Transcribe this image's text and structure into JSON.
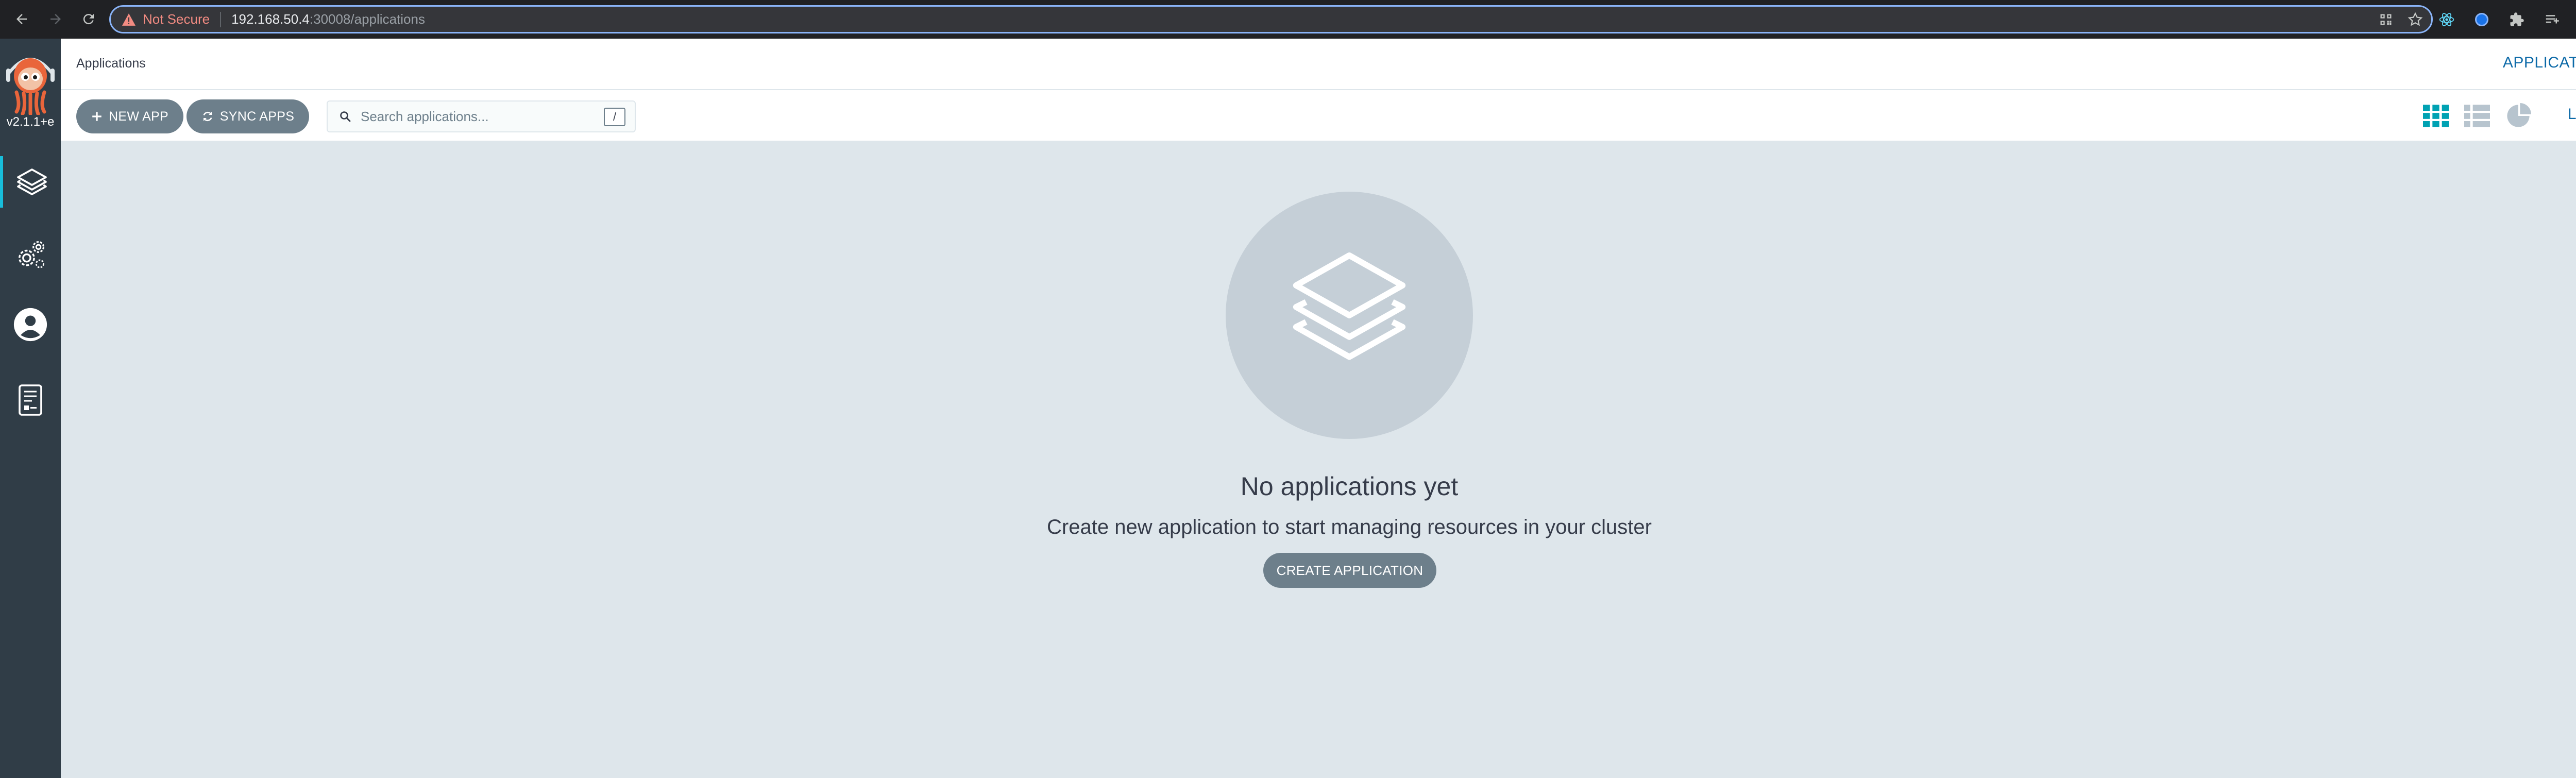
{
  "browser": {
    "security_label": "Not Secure",
    "url_host": "192.168.50.4",
    "url_path": ":30008/applications"
  },
  "sidebar": {
    "version": "v2.1.1+e",
    "items": [
      {
        "name": "applications",
        "icon": "layers-icon",
        "active": true
      },
      {
        "name": "settings",
        "icon": "gears-icon",
        "active": false
      },
      {
        "name": "user-info",
        "icon": "user-circle-icon",
        "active": false
      },
      {
        "name": "documentation",
        "icon": "docs-icon",
        "active": false
      }
    ]
  },
  "header": {
    "title": "Applications",
    "right_title": "APPLICATIONS"
  },
  "toolbar": {
    "new_app_label": "NEW APP",
    "sync_apps_label": "SYNC APPS",
    "search_placeholder": "Search applications...",
    "search_shortcut": "/",
    "views": [
      "tiles-view-icon",
      "list-view-icon",
      "summary-view-icon"
    ],
    "active_view": "tiles-view-icon",
    "logout_label": "Log out"
  },
  "empty_state": {
    "icon": "layers-icon",
    "title": "No applications yet",
    "subtitle": "Create new application to start managing resources in your cluster",
    "button_label": "CREATE APPLICATION"
  },
  "colors": {
    "accent": "#0d6aa8",
    "active_view": "#00a2b3",
    "button_bg": "#6d7f8b",
    "sidebar_bg": "#303d47",
    "main_bg": "#dee6eb",
    "sidebar_active_bar": "#18bedb"
  }
}
